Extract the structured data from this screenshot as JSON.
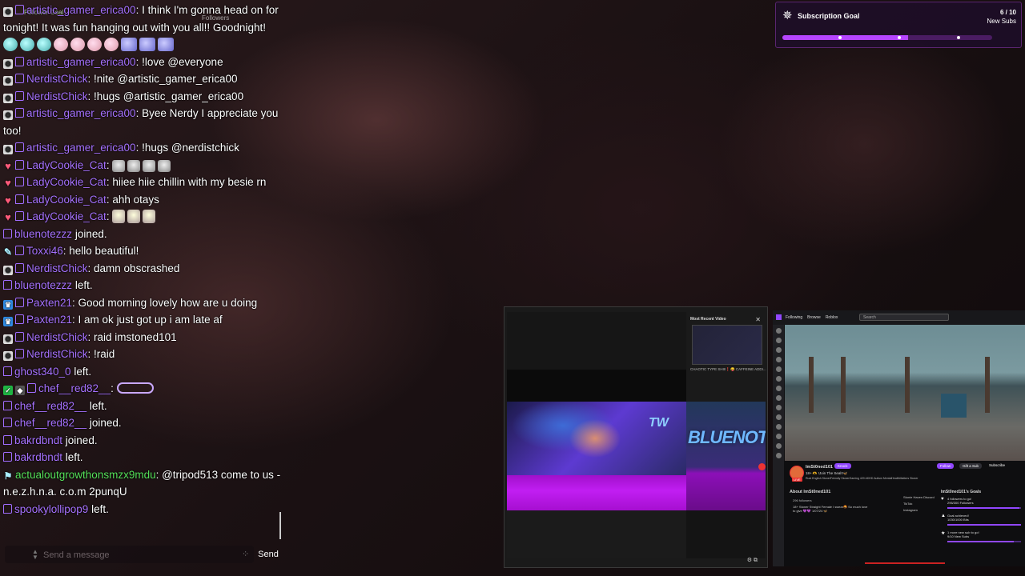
{
  "overlay": {
    "bg_label_left": "Follower Goal",
    "bg_label_right": "Followers"
  },
  "chat": {
    "messages": [
      {
        "badges": [
          "vip",
          "prime"
        ],
        "user": "artistic_gamer_erica00",
        "color": "purple",
        "text": ": I think I'm gonna head on for tonight! It was fun hanging out with you all!! Goodnight!"
      },
      {
        "badges": [
          "vip",
          "prime"
        ],
        "user": "artistic_gamer_erica00",
        "color": "purple",
        "text": ": !love @everyone"
      },
      {
        "badges": [
          "vip",
          "prime"
        ],
        "user": "NerdistChick",
        "color": "purple",
        "text": ": !nite @artistic_gamer_erica00"
      },
      {
        "badges": [
          "vip",
          "prime"
        ],
        "user": "NerdistChick",
        "color": "purple",
        "text": ": !hugs @artistic_gamer_erica00"
      },
      {
        "badges": [
          "vip",
          "prime"
        ],
        "user": "artistic_gamer_erica00",
        "color": "purple",
        "text": ": Byee Nerdy I appreciate you too!"
      },
      {
        "badges": [
          "vip",
          "prime"
        ],
        "user": "artistic_gamer_erica00",
        "color": "purple",
        "text": ": !hugs @nerdistchick"
      },
      {
        "badges": [
          "heart",
          "prime"
        ],
        "user": "LadyCookie_Cat",
        "color": "purple",
        "text": ":"
      },
      {
        "badges": [
          "heart",
          "prime"
        ],
        "user": "LadyCookie_Cat",
        "color": "purple",
        "text": ": hiiee hiie chillin with my besie rn"
      },
      {
        "badges": [
          "heart",
          "prime"
        ],
        "user": "LadyCookie_Cat",
        "color": "purple",
        "text": ": ahh otays"
      },
      {
        "badges": [
          "heart",
          "prime"
        ],
        "user": "LadyCookie_Cat",
        "color": "purple",
        "text": ":"
      },
      {
        "badges": [
          "prime"
        ],
        "user": "bluenotezzz",
        "color": "purple",
        "text": " joined."
      },
      {
        "badges": [
          "pen",
          "prime"
        ],
        "user": "Toxxi46",
        "color": "purple",
        "text": ": hello beautiful!"
      },
      {
        "badges": [
          "vip",
          "prime"
        ],
        "user": "NerdistChick",
        "color": "purple",
        "text": ": damn obscrashed"
      },
      {
        "badges": [
          "prime"
        ],
        "user": "bluenotezzz",
        "color": "purple",
        "text": " left."
      },
      {
        "badges": [
          "sub",
          "prime"
        ],
        "user": "Paxten21",
        "color": "purple",
        "text": ": Good morning lovely how are u doing"
      },
      {
        "badges": [
          "sub",
          "prime"
        ],
        "user": "Paxten21",
        "color": "purple",
        "text": ": I am ok just got up i am late af"
      },
      {
        "badges": [
          "vip",
          "prime"
        ],
        "user": "NerdistChick",
        "color": "purple",
        "text": ": raid imstoned101"
      },
      {
        "badges": [
          "vip",
          "prime"
        ],
        "user": "NerdistChick",
        "color": "purple",
        "text": ": !raid"
      },
      {
        "badges": [
          "prime"
        ],
        "user": "ghost340_0",
        "color": "purple",
        "text": " left."
      },
      {
        "badges": [
          "mod",
          "diamond",
          "prime"
        ],
        "user": "chef__red82__",
        "color": "purple",
        "text": ":"
      },
      {
        "badges": [
          "prime"
        ],
        "user": "chef__red82__",
        "color": "purple",
        "text": " left."
      },
      {
        "badges": [
          "prime"
        ],
        "user": "chef__red82__",
        "color": "purple",
        "text": " joined."
      },
      {
        "badges": [
          "prime"
        ],
        "user": "bakrdbndt",
        "color": "purple",
        "text": " joined."
      },
      {
        "badges": [
          "prime"
        ],
        "user": "bakrdbndt",
        "color": "purple",
        "text": " left."
      },
      {
        "badges": [
          "bot"
        ],
        "user": "actualoutgrowthonsmzx9mdu",
        "color": "green",
        "text": ": @tripod513 come to us - n.e.z.h.n.a. c.o.m 2punqU"
      },
      {
        "badges": [
          "prime"
        ],
        "user": "spookylollipop9",
        "color": "purple",
        "text": " left."
      }
    ],
    "input_placeholder": "Send a message",
    "send_label": "Send"
  },
  "sub_goal": {
    "title": "Subscription Goal",
    "count": "6 / 10",
    "unit_label": "New Subs",
    "progress_fraction": 0.6
  },
  "screenshot_a": {
    "recent_title": "Most Recent Video",
    "recent_caption": "CHAOTIC TYPE SHIII❗😝 CAFFEINE ADDI...",
    "banner_text": "BLUENOTEZ",
    "banner_text_small": "TW"
  },
  "screenshot_b": {
    "nav": [
      "Following",
      "Browse",
      "Roblox"
    ],
    "search_placeholder": "Search",
    "channel_name": "ImSt0ned101",
    "knock_label": "Knock",
    "stream_title": "18+ 🫶 !Join The Seal!!🦋",
    "tags": "Rust  English  StonerFriendly  StonerGaming  420  ADHD  Autism  MentalHealthMatters  Stoner",
    "follow_label": "Follow",
    "gift_label": "Gift a Sub",
    "subscribe_label": "Subscribe",
    "about_title": "About ImSt0ned101",
    "followers": "296 followers",
    "bio": "18+ Stoner Straight Female I swear🤬 So much love to give 💜💜 1/07/24 🦋",
    "links": [
      "Stonie Haven Discord",
      "TikTok",
      "Instagram"
    ],
    "goals_title": "ImSt0ned101's Goals",
    "goals": [
      {
        "title": "4 followers to go!",
        "detail": "296/300 Followers",
        "fraction": 0.98
      },
      {
        "title": "Goal achieved!",
        "detail": "1030/1000 Bits",
        "fraction": 1.0
      },
      {
        "title": "1 more new sub to go!",
        "detail": "9/10 New Subs",
        "fraction": 0.9
      }
    ]
  }
}
